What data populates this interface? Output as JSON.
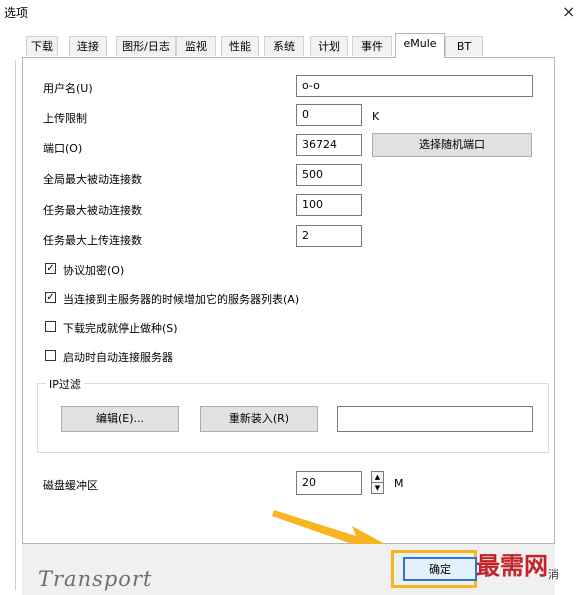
{
  "window": {
    "title": "选项",
    "close_glyph": "×"
  },
  "tabs": [
    {
      "label": "下载"
    },
    {
      "label": "连接"
    },
    {
      "label": "图形/日志"
    },
    {
      "label": "监视"
    },
    {
      "label": "性能"
    },
    {
      "label": "系统"
    },
    {
      "label": "计划"
    },
    {
      "label": "事件"
    },
    {
      "label": "eMule"
    },
    {
      "label": "BT"
    }
  ],
  "active_tab": "eMule",
  "emule": {
    "username_label": "用户名(U)",
    "username_value": "o-o",
    "upload_limit_label": "上传限制",
    "upload_limit_value": "0",
    "upload_limit_unit": "K",
    "port_label": "端口(O)",
    "port_value": "36724",
    "random_port_button": "选择随机端口",
    "global_max_passive_label": "全局最大被动连接数",
    "global_max_passive_value": "500",
    "task_max_passive_label": "任务最大被动连接数",
    "task_max_passive_value": "100",
    "task_max_upload_label": "任务最大上传连接数",
    "task_max_upload_value": "2",
    "protocol_encryption": {
      "label": "协议加密(O)",
      "checked": true
    },
    "add_server_list": {
      "label": "当连接到主服务器的时候增加它的服务器列表(A)",
      "checked": true
    },
    "stop_seeding": {
      "label": "下载完成就停止做种(S)",
      "checked": false
    },
    "auto_connect": {
      "label": "启动时自动连接服务器",
      "checked": false
    },
    "ip_filter": {
      "legend": "IP过滤",
      "edit_button": "编辑(E)...",
      "reload_button": "重新装入(R)",
      "path_value": ""
    },
    "disk_buffer_label": "磁盘缓冲区",
    "disk_buffer_value": "20",
    "disk_buffer_unit": "M"
  },
  "footer": {
    "brand_text": "Transport",
    "ok_button": "确定",
    "watermark": "最需网",
    "cancel_partial": "消"
  },
  "colors": {
    "highlight_frame": "#f8b521",
    "arrow": "#f8b521",
    "ok_border": "#2a77d4",
    "watermark": "#c4232a"
  }
}
